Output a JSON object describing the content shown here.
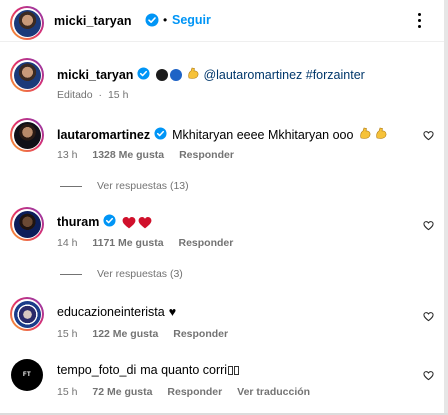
{
  "header": {
    "username": "micki_taryan",
    "separator": "•",
    "follow_label": "Seguir",
    "more_icon": "more-horizontal-icon"
  },
  "caption": {
    "username": "micki_taryan",
    "text": "@lautaromartinez #forzainter",
    "emoji_colors": [
      "#1c1c1c",
      "#1e63c6"
    ],
    "meta_edited": "Editado",
    "meta_sep": "·",
    "meta_time": "15 h"
  },
  "comments": [
    {
      "username": "lautaromartinez",
      "verified": true,
      "text": "Mkhitaryan eeee Mkhitaryan ooo",
      "time": "13 h",
      "likes": "1328 Me gusta",
      "reply": "Responder",
      "view_replies": "Ver respuestas (13)"
    },
    {
      "username": "thuram",
      "verified": true,
      "text": "",
      "time": "14 h",
      "likes": "1171 Me gusta",
      "reply": "Responder",
      "view_replies": "Ver respuestas (3)"
    },
    {
      "username": "educazioneinterista",
      "verified": false,
      "text": "♥",
      "time": "15 h",
      "likes": "122 Me gusta",
      "reply": "Responder"
    },
    {
      "username": "tempo_foto_di",
      "verified": false,
      "text": "ma quanto corri",
      "time": "15 h",
      "likes": "72 Me gusta",
      "reply": "Responder",
      "translate": "Ver traducción",
      "avatar_text": "FT"
    }
  ],
  "colors": {
    "accent": "#0095f6",
    "verified": "#0095f6",
    "muted": "#737373",
    "heart": "#d0102b"
  }
}
